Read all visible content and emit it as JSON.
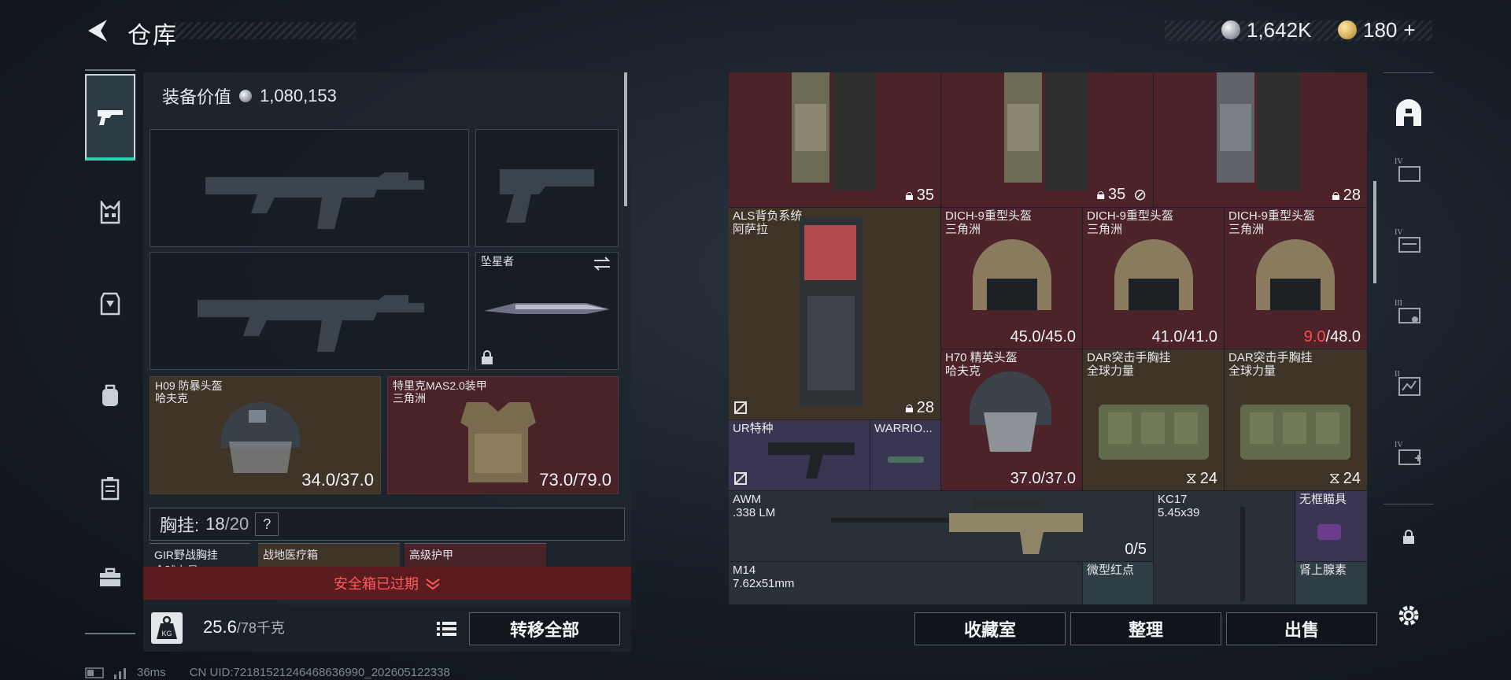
{
  "header": {
    "title": "仓库",
    "currency_silver": "1,642K",
    "currency_gold": "180",
    "currency_gold_plus": "+"
  },
  "left_nav": {
    "items": [
      "pistol-icon",
      "vest-icon",
      "armor-icon",
      "backpack-icon",
      "case-icon",
      "toolbox-icon"
    ]
  },
  "loadout": {
    "equip_value_label": "装备价值",
    "equip_value": "1,080,153",
    "melee": {
      "name": "坠星者"
    },
    "helmet": {
      "name": "H09 防暴头盔",
      "brand": "哈夫克",
      "durability": "34.0/37.0"
    },
    "armor": {
      "name": "特里克MAS2.0装甲",
      "brand": "三角洲",
      "durability": "73.0/79.0"
    },
    "chest_rig": {
      "label": "胸挂:",
      "used": "18",
      "capacity": "/20",
      "help": "?"
    },
    "mini_slots": [
      {
        "name": "GIR野战胸挂",
        "sub": "全球力量"
      },
      {
        "name": "战地医疗箱",
        "sub": ""
      },
      {
        "name": "高级护甲",
        "sub": ""
      }
    ],
    "safe_box_expired": "安全箱已过期",
    "weight_current": "25.6",
    "weight_max": "/78千克",
    "weight_icon_label": "KG",
    "transfer_all": "转移全部"
  },
  "stash": {
    "items": [
      {
        "id": "bp1",
        "name": "",
        "count": "35",
        "count_icon": "lock-icon",
        "no_insure": false
      },
      {
        "id": "bp2",
        "name": "",
        "count": "35",
        "count_icon": "lock-icon",
        "no_insure": true
      },
      {
        "id": "bp3",
        "name": "",
        "count": "28",
        "count_icon": "lock-icon",
        "no_insure": false
      },
      {
        "id": "als",
        "name": "ALS背负系统",
        "brand": "阿萨拉",
        "count": "28",
        "no_insure": true
      },
      {
        "id": "dich1",
        "name": "DICH-9重型头盔",
        "brand": "三角洲",
        "dur_cur": "45.0",
        "dur_max": "/45.0",
        "low": false
      },
      {
        "id": "dich2",
        "name": "DICH-9重型头盔",
        "brand": "三角洲",
        "dur_cur": "41.0",
        "dur_max": "/41.0",
        "low": false
      },
      {
        "id": "dich3",
        "name": "DICH-9重型头盔",
        "brand": "三角洲",
        "dur_cur": "9.0",
        "dur_max": "/48.0",
        "low": true
      },
      {
        "id": "h70",
        "name": "H70 精英头盔",
        "brand": "哈夫克",
        "dur_cur": "37.0",
        "dur_max": "/37.0",
        "low": false
      },
      {
        "id": "dar1",
        "name": "DAR突击手胸挂",
        "brand": "全球力量",
        "count": "24"
      },
      {
        "id": "dar2",
        "name": "DAR突击手胸挂",
        "brand": "全球力量",
        "count": "24"
      },
      {
        "id": "ur",
        "name": "UR特种",
        "no_insure": true
      },
      {
        "id": "warrior",
        "name": "WARRIO..."
      },
      {
        "id": "awm",
        "name": "AWM",
        "caliber": ".338 LM",
        "ammo": "0/5"
      },
      {
        "id": "kc17",
        "name": "KC17",
        "caliber": "5.45x39"
      },
      {
        "id": "scope",
        "name": "无框瞄具"
      },
      {
        "id": "m14",
        "name": "M14",
        "caliber": "7.62x51mm"
      },
      {
        "id": "reddot",
        "name": "微型红点"
      },
      {
        "id": "adrenaline",
        "name": "肾上腺素"
      }
    ],
    "buttons": {
      "collection": "收藏室",
      "sort": "整理",
      "sell": "出售"
    }
  },
  "right_nav": {
    "tiers": [
      "",
      "IV",
      "IV",
      "III",
      "II",
      "IV",
      "",
      ""
    ]
  },
  "status_bar": {
    "ping": "36ms",
    "uid": "CN UID:72181521246468636990_202605122338"
  },
  "colors": {
    "accent_teal": "#2fd0b0",
    "red_cell": "#4b2329",
    "brown_cell": "#3d3326",
    "warning_red": "#ff4a4a"
  }
}
